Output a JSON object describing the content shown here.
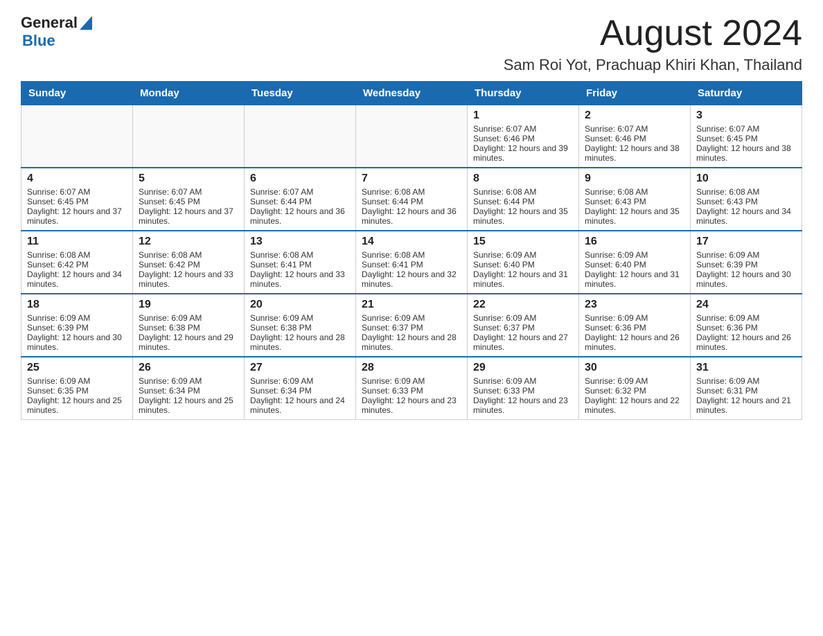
{
  "header": {
    "logo": {
      "text_general": "General",
      "text_blue": "Blue",
      "alt": "GeneralBlue logo"
    },
    "title": "August 2024",
    "subtitle": "Sam Roi Yot, Prachuap Khiri Khan, Thailand"
  },
  "weekdays": [
    "Sunday",
    "Monday",
    "Tuesday",
    "Wednesday",
    "Thursday",
    "Friday",
    "Saturday"
  ],
  "weeks": [
    [
      {
        "day": "",
        "empty": true
      },
      {
        "day": "",
        "empty": true
      },
      {
        "day": "",
        "empty": true
      },
      {
        "day": "",
        "empty": true
      },
      {
        "day": "1",
        "sunrise": "6:07 AM",
        "sunset": "6:46 PM",
        "daylight": "12 hours and 39 minutes."
      },
      {
        "day": "2",
        "sunrise": "6:07 AM",
        "sunset": "6:46 PM",
        "daylight": "12 hours and 38 minutes."
      },
      {
        "day": "3",
        "sunrise": "6:07 AM",
        "sunset": "6:45 PM",
        "daylight": "12 hours and 38 minutes."
      }
    ],
    [
      {
        "day": "4",
        "sunrise": "6:07 AM",
        "sunset": "6:45 PM",
        "daylight": "12 hours and 37 minutes."
      },
      {
        "day": "5",
        "sunrise": "6:07 AM",
        "sunset": "6:45 PM",
        "daylight": "12 hours and 37 minutes."
      },
      {
        "day": "6",
        "sunrise": "6:07 AM",
        "sunset": "6:44 PM",
        "daylight": "12 hours and 36 minutes."
      },
      {
        "day": "7",
        "sunrise": "6:08 AM",
        "sunset": "6:44 PM",
        "daylight": "12 hours and 36 minutes."
      },
      {
        "day": "8",
        "sunrise": "6:08 AM",
        "sunset": "6:44 PM",
        "daylight": "12 hours and 35 minutes."
      },
      {
        "day": "9",
        "sunrise": "6:08 AM",
        "sunset": "6:43 PM",
        "daylight": "12 hours and 35 minutes."
      },
      {
        "day": "10",
        "sunrise": "6:08 AM",
        "sunset": "6:43 PM",
        "daylight": "12 hours and 34 minutes."
      }
    ],
    [
      {
        "day": "11",
        "sunrise": "6:08 AM",
        "sunset": "6:42 PM",
        "daylight": "12 hours and 34 minutes."
      },
      {
        "day": "12",
        "sunrise": "6:08 AM",
        "sunset": "6:42 PM",
        "daylight": "12 hours and 33 minutes."
      },
      {
        "day": "13",
        "sunrise": "6:08 AM",
        "sunset": "6:41 PM",
        "daylight": "12 hours and 33 minutes."
      },
      {
        "day": "14",
        "sunrise": "6:08 AM",
        "sunset": "6:41 PM",
        "daylight": "12 hours and 32 minutes."
      },
      {
        "day": "15",
        "sunrise": "6:09 AM",
        "sunset": "6:40 PM",
        "daylight": "12 hours and 31 minutes."
      },
      {
        "day": "16",
        "sunrise": "6:09 AM",
        "sunset": "6:40 PM",
        "daylight": "12 hours and 31 minutes."
      },
      {
        "day": "17",
        "sunrise": "6:09 AM",
        "sunset": "6:39 PM",
        "daylight": "12 hours and 30 minutes."
      }
    ],
    [
      {
        "day": "18",
        "sunrise": "6:09 AM",
        "sunset": "6:39 PM",
        "daylight": "12 hours and 30 minutes."
      },
      {
        "day": "19",
        "sunrise": "6:09 AM",
        "sunset": "6:38 PM",
        "daylight": "12 hours and 29 minutes."
      },
      {
        "day": "20",
        "sunrise": "6:09 AM",
        "sunset": "6:38 PM",
        "daylight": "12 hours and 28 minutes."
      },
      {
        "day": "21",
        "sunrise": "6:09 AM",
        "sunset": "6:37 PM",
        "daylight": "12 hours and 28 minutes."
      },
      {
        "day": "22",
        "sunrise": "6:09 AM",
        "sunset": "6:37 PM",
        "daylight": "12 hours and 27 minutes."
      },
      {
        "day": "23",
        "sunrise": "6:09 AM",
        "sunset": "6:36 PM",
        "daylight": "12 hours and 26 minutes."
      },
      {
        "day": "24",
        "sunrise": "6:09 AM",
        "sunset": "6:36 PM",
        "daylight": "12 hours and 26 minutes."
      }
    ],
    [
      {
        "day": "25",
        "sunrise": "6:09 AM",
        "sunset": "6:35 PM",
        "daylight": "12 hours and 25 minutes."
      },
      {
        "day": "26",
        "sunrise": "6:09 AM",
        "sunset": "6:34 PM",
        "daylight": "12 hours and 25 minutes."
      },
      {
        "day": "27",
        "sunrise": "6:09 AM",
        "sunset": "6:34 PM",
        "daylight": "12 hours and 24 minutes."
      },
      {
        "day": "28",
        "sunrise": "6:09 AM",
        "sunset": "6:33 PM",
        "daylight": "12 hours and 23 minutes."
      },
      {
        "day": "29",
        "sunrise": "6:09 AM",
        "sunset": "6:33 PM",
        "daylight": "12 hours and 23 minutes."
      },
      {
        "day": "30",
        "sunrise": "6:09 AM",
        "sunset": "6:32 PM",
        "daylight": "12 hours and 22 minutes."
      },
      {
        "day": "31",
        "sunrise": "6:09 AM",
        "sunset": "6:31 PM",
        "daylight": "12 hours and 21 minutes."
      }
    ]
  ],
  "labels": {
    "sunrise": "Sunrise:",
    "sunset": "Sunset:",
    "daylight": "Daylight:"
  }
}
